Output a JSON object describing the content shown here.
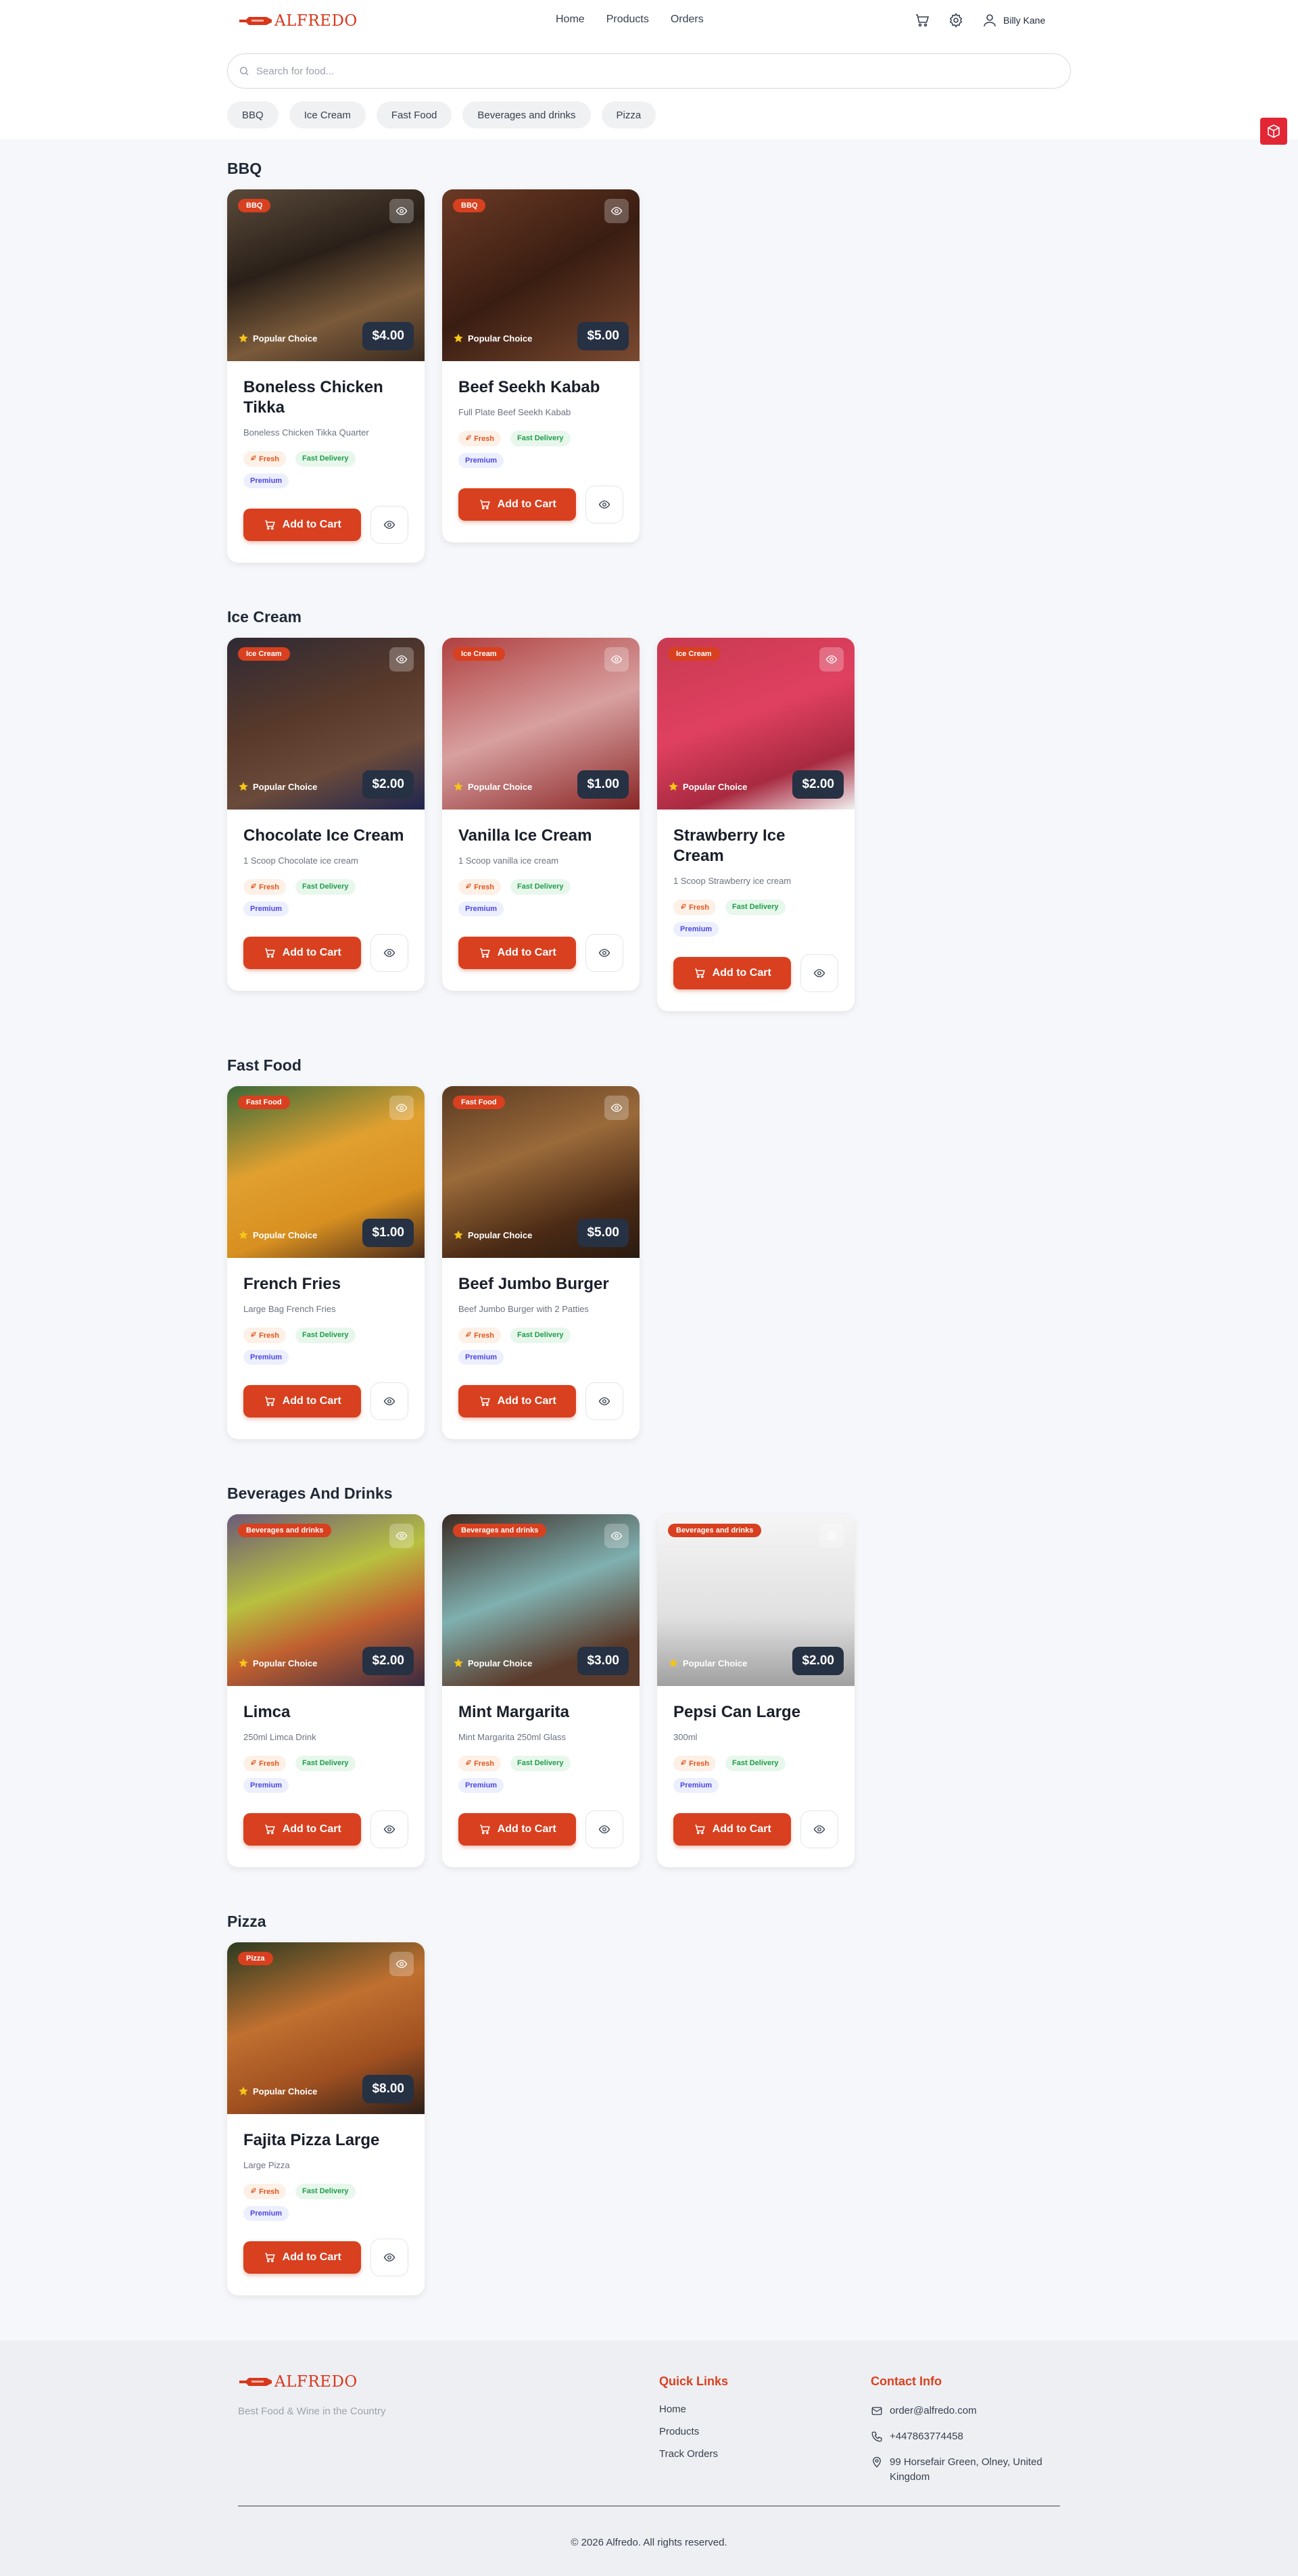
{
  "brand": {
    "name": "ALFREDO",
    "tagline": "Best Food & Wine in the Country",
    "accent": "#d8401f"
  },
  "nav": {
    "items": [
      "Home",
      "Products",
      "Orders"
    ]
  },
  "user": {
    "name": "Billy Kane"
  },
  "search": {
    "placeholder": "Search for food..."
  },
  "categories": [
    "BBQ",
    "Ice Cream",
    "Fast Food",
    "Beverages and drinks",
    "Pizza"
  ],
  "labels": {
    "popular": "Popular Choice",
    "add_to_cart": "Add to Cart",
    "fresh": "Fresh",
    "fast_delivery": "Fast Delivery",
    "premium": "Premium"
  },
  "sections": [
    {
      "title": "BBQ",
      "items": [
        {
          "badge": "BBQ",
          "name": "Boneless Chicken Tikka",
          "desc": "Boneless Chicken Tikka Quarter",
          "price": "$4.00"
        },
        {
          "badge": "BBQ",
          "name": "Beef Seekh Kabab",
          "desc": "Full Plate Beef Seekh Kabab",
          "price": "$5.00"
        }
      ]
    },
    {
      "title": "Ice Cream",
      "items": [
        {
          "badge": "Ice Cream",
          "name": "Chocolate Ice Cream",
          "desc": "1 Scoop Chocolate ice cream",
          "price": "$2.00"
        },
        {
          "badge": "Ice Cream",
          "name": "Vanilla Ice Cream",
          "desc": "1 Scoop vanilla ice cream",
          "price": "$1.00"
        },
        {
          "badge": "Ice Cream",
          "name": "Strawberry Ice Cream",
          "desc": "1 Scoop Strawberry ice cream",
          "price": "$2.00"
        }
      ]
    },
    {
      "title": "Fast Food",
      "items": [
        {
          "badge": "Fast Food",
          "name": "French Fries",
          "desc": "Large Bag French Fries",
          "price": "$1.00"
        },
        {
          "badge": "Fast Food",
          "name": "Beef Jumbo Burger",
          "desc": "Beef Jumbo Burger with 2 Patties",
          "price": "$5.00"
        }
      ]
    },
    {
      "title": "Beverages And Drinks",
      "items": [
        {
          "badge": "Beverages and drinks",
          "name": "Limca",
          "desc": "250ml Limca Drink",
          "price": "$2.00"
        },
        {
          "badge": "Beverages and drinks",
          "name": "Mint Margarita",
          "desc": "Mint Margarita 250ml Glass",
          "price": "$3.00"
        },
        {
          "badge": "Beverages and drinks",
          "name": "Pepsi Can Large",
          "desc": "300ml",
          "price": "$2.00"
        }
      ]
    },
    {
      "title": "Pizza",
      "items": [
        {
          "badge": "Pizza",
          "name": "Fajita Pizza Large",
          "desc": "Large Pizza",
          "price": "$8.00"
        }
      ]
    }
  ],
  "footer": {
    "quick_links_title": "Quick Links",
    "quick_links": [
      "Home",
      "Products",
      "Track Orders"
    ],
    "contact_title": "Contact Info",
    "email": "order@alfredo.com",
    "phone": "+447863774458",
    "address": "99 Horsefair Green, Olney, United Kingdom",
    "copyright": "© 2026 Alfredo. All rights reserved."
  }
}
